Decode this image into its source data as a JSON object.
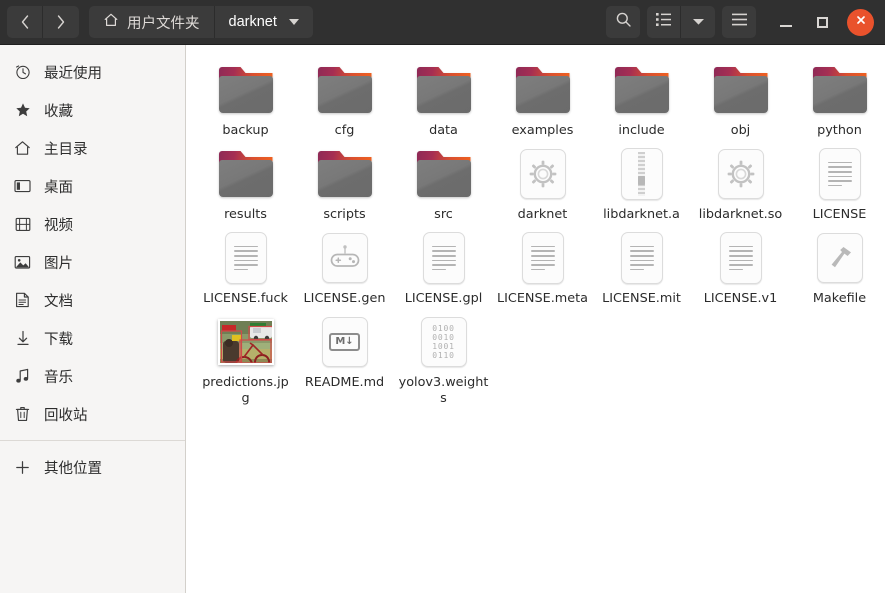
{
  "window": {
    "title": "darknet",
    "accent_close": "#e9522c",
    "headerbar_bg": "#303030",
    "sidebar_bg": "#f6f5f4",
    "content_bg": "#ffffff"
  },
  "headerbar": {
    "back_label": "‹",
    "forward_label": "›",
    "breadcrumbs": [
      {
        "label": "用户文件夹",
        "icon": "home-icon",
        "current": false
      },
      {
        "label": "darknet",
        "icon": "",
        "current": true
      }
    ],
    "buttons": {
      "search": "search-icon",
      "view_list": "list-view-icon",
      "view_dropdown": "chevron-down-icon",
      "menu": "hamburger-menu-icon",
      "minimize": "minimize-icon",
      "maximize": "maximize-icon",
      "close": "close-icon"
    }
  },
  "sidebar": {
    "items": [
      {
        "label": "最近使用",
        "icon": "clock-icon"
      },
      {
        "label": "收藏",
        "icon": "star-icon"
      },
      {
        "label": "主目录",
        "icon": "home-icon"
      },
      {
        "label": "桌面",
        "icon": "desktop-icon"
      },
      {
        "label": "视频",
        "icon": "video-icon"
      },
      {
        "label": "图片",
        "icon": "picture-icon"
      },
      {
        "label": "文档",
        "icon": "document-icon"
      },
      {
        "label": "下载",
        "icon": "download-icon"
      },
      {
        "label": "音乐",
        "icon": "music-note-icon"
      },
      {
        "label": "回收站",
        "icon": "trash-icon"
      }
    ],
    "other_locations": {
      "label": "其他位置",
      "icon": "plus-icon"
    }
  },
  "files": [
    {
      "name": "backup",
      "type": "folder"
    },
    {
      "name": "cfg",
      "type": "folder"
    },
    {
      "name": "data",
      "type": "folder"
    },
    {
      "name": "examples",
      "type": "folder"
    },
    {
      "name": "include",
      "type": "folder"
    },
    {
      "name": "obj",
      "type": "folder"
    },
    {
      "name": "python",
      "type": "folder"
    },
    {
      "name": "results",
      "type": "folder"
    },
    {
      "name": "scripts",
      "type": "folder"
    },
    {
      "name": "src",
      "type": "folder"
    },
    {
      "name": "darknet",
      "type": "executable"
    },
    {
      "name": "libdarknet.a",
      "type": "archive"
    },
    {
      "name": "libdarknet.so",
      "type": "executable"
    },
    {
      "name": "LICENSE",
      "type": "text"
    },
    {
      "name": "LICENSE.fuck",
      "type": "text"
    },
    {
      "name": "LICENSE.gen",
      "type": "gamepad"
    },
    {
      "name": "LICENSE.gpl",
      "type": "text"
    },
    {
      "name": "LICENSE.meta",
      "type": "text"
    },
    {
      "name": "LICENSE.mit",
      "type": "text"
    },
    {
      "name": "LICENSE.v1",
      "type": "text"
    },
    {
      "name": "Makefile",
      "type": "makefile"
    },
    {
      "name": "predictions.jpg",
      "type": "image"
    },
    {
      "name": "README.md",
      "type": "markdown",
      "badge": "M↓"
    },
    {
      "name": "yolov3.weights",
      "type": "binary",
      "binary_rows": [
        "0100",
        "0010",
        "1001",
        "0110"
      ]
    }
  ]
}
